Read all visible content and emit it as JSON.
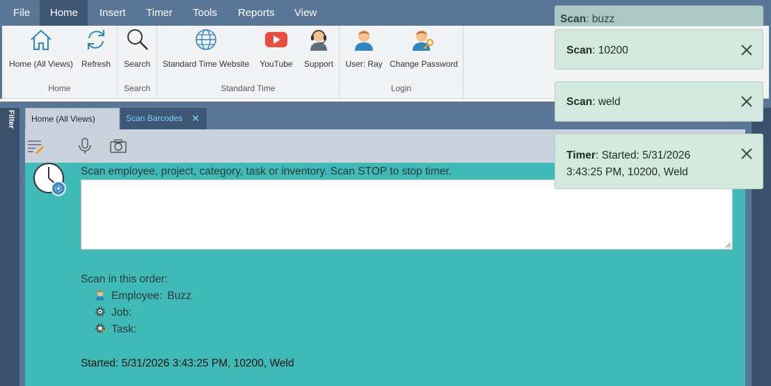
{
  "menu": {
    "items": [
      "File",
      "Home",
      "Insert",
      "Timer",
      "Tools",
      "Reports",
      "View"
    ],
    "active": "Home"
  },
  "ribbon": {
    "groups": {
      "home": {
        "label": "Home",
        "buttons": [
          {
            "label": "Home (All Views)",
            "icon": "house-icon"
          },
          {
            "label": "Refresh",
            "icon": "refresh-icon"
          }
        ]
      },
      "search": {
        "label": "Search",
        "buttons": [
          {
            "label": "Search",
            "icon": "magnifier-icon"
          }
        ]
      },
      "standard_time": {
        "label": "Standard Time",
        "buttons": [
          {
            "label": "Standard Time Website",
            "icon": "globe-icon"
          },
          {
            "label": "YouTube",
            "icon": "youtube-icon"
          },
          {
            "label": "Support",
            "icon": "headset-user-icon"
          }
        ]
      },
      "login": {
        "label": "Login",
        "buttons": [
          {
            "label": "User: Ray",
            "icon": "user-icon"
          },
          {
            "label": "Change Password",
            "icon": "user-key-icon"
          }
        ]
      }
    }
  },
  "sidebar": {
    "filter_label": "Filter"
  },
  "tabs": [
    {
      "label": "Home (All Views)",
      "active": false
    },
    {
      "label": "Scan Barcodes",
      "active": true
    }
  ],
  "scan": {
    "instruction": "Scan employee, project, category, task or inventory. Scan STOP to stop timer.",
    "input_value": "",
    "order_title": "Scan in this order:",
    "order_items": [
      {
        "label": "Employee:",
        "value": "Buzz",
        "icon": "employee-icon"
      },
      {
        "label": "Job:",
        "value": "",
        "icon": "gear-icon"
      },
      {
        "label": "Task:",
        "value": "",
        "icon": "task-gear-icon"
      }
    ],
    "status": "Started: 5/31/2026 3:43:25 PM, 10200, Weld"
  },
  "toasts": [
    {
      "title": "Scan",
      "text": "buzz"
    },
    {
      "title": "Scan",
      "text": "10200"
    },
    {
      "title": "Scan",
      "text": "weld"
    },
    {
      "title": "Timer",
      "text": "Started: 5/31/2026 3:43:25 PM, 10200, Weld"
    }
  ],
  "colors": {
    "menubar": "#5a7696",
    "panel": "#3fbab6",
    "toast": "#d3e8de",
    "accent": "#2e86c1"
  }
}
